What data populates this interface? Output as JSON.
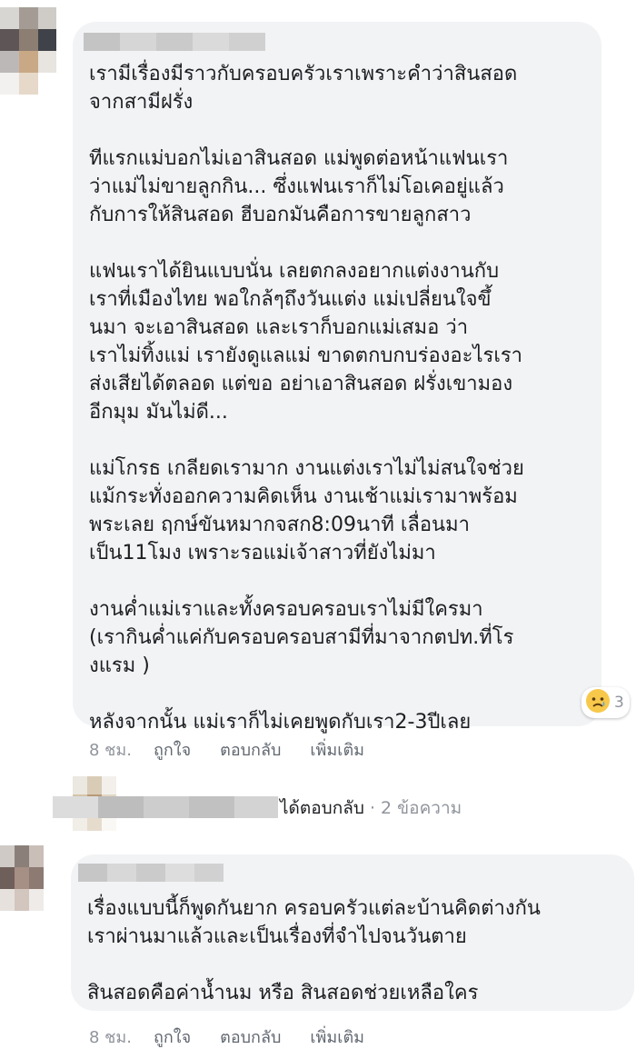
{
  "comment1": {
    "paragraphs": [
      "เรามีเรื่องมีราวกับครอบครัวเราเพราะคำว่าสินสอด\nจากสามีฝรั่ง",
      "ทีแรกแม่บอกไม่เอาสินสอด แม่พูดต่อหน้าแฟนเรา\nว่าแม่ไม่ขายลูกกิน... ซึ่งแฟนเราก็ไม่โอเคอยู่แล้ว\nกับการให้สินสอด ฮีบอกมันคือการขายลูกสาว",
      "แฟนเราได้ยินแบบนั่น เลยตกลงอยากแต่งงานกับ\nเราที่เมืองไทย พอใกล้ๆถึงวันแต่ง แม่เปลี่ยนใจขึ้\nนมา จะเอาสินสอด และเราก็บอกแม่เสมอ ว่า\nเราไม่ทิ้งแม่ เรายังดูแลแม่ ขาดตกบกบร่องอะไรเรา\nส่งเสียได้ตลอด แต่ขอ อย่าเอาสินสอด ฝรั่งเขามอง\nอีกมุม มันไม่ดี...",
      "แม่โกรธ เกลียดเรามาก งานแต่งเราไม่ไม่สนใจช่วย\nแม้กระทั่งออกความคิดเห็น งานเช้าแม่เรามาพร้อม\nพระเลย ฤกษ์ขันหมากจสก8:09นาที เลื่อนมา\nเป็น11โมง เพราะรอแม่เจ้าสาวที่ยังไม่มา",
      "งานค่ำแม่เราและทั้งครอบครอบเราไม่มีใครมา\n(เรากินค่ำแค่กับครอบครอบสามีที่มาจากตปท.ที่โร\nงแรม )",
      "หลังจากนั้น แม่เราก็ไม่เคยพูดกับเรา2-3ปีเลย"
    ],
    "reaction_count": "3",
    "reaction_icon": "sad-face-icon",
    "time": "8 ชม.",
    "like": "ถูกใจ",
    "reply": "ตอบกลับ",
    "more": "เพิ่มเติม"
  },
  "reply_summary": {
    "action": "ได้ตอบกลับ",
    "meta": " · 2 ข้อความ"
  },
  "comment2": {
    "paragraphs": [
      "เรื่องแบบนี้ก็พูดกันยาก ครอบครัวแต่ละบ้านคิดต่างกัน\nเราผ่านมาแล้วและเป็นเรื่องที่จำไปจนวันตาย",
      "สินสอดคือค่าน้ำนม หรือ สินสอดช่วยเหลือใคร"
    ],
    "time": "8 ชม.",
    "like": "ถูกใจ",
    "reply": "ตอบกลับ",
    "more": "เพิ่มเติม"
  },
  "colors": {
    "bubble": "#f2f3f5",
    "action_text": "#616770",
    "meta_text": "#90949c"
  }
}
